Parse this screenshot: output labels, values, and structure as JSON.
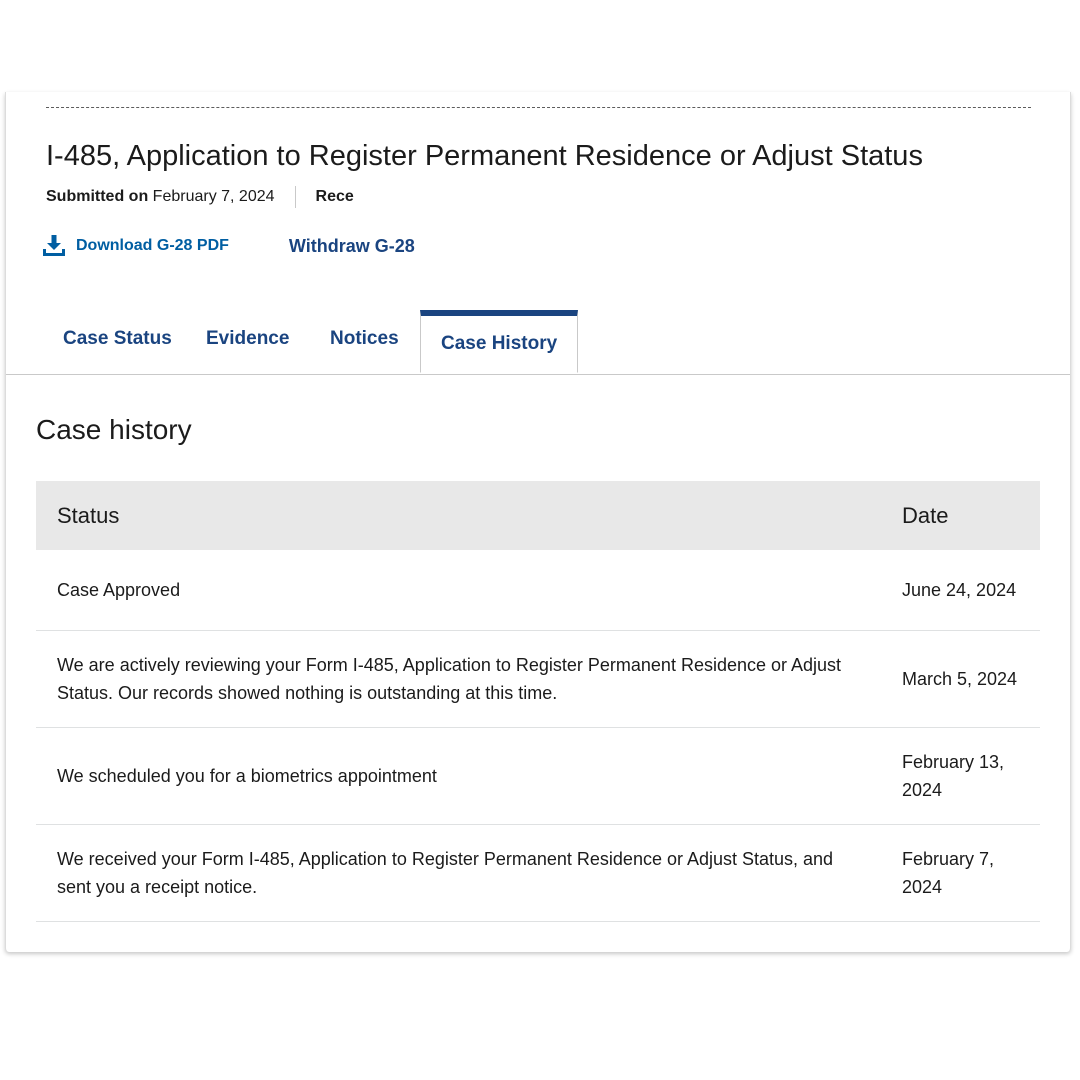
{
  "case": {
    "form_title": "I-485, Application to Register Permanent Residence or Adjust Status",
    "submitted_label": "Submitted on",
    "submitted_date": "February 7, 2024",
    "receipt_label_partial": "Rece"
  },
  "actions": {
    "download_label": "Download G-28 PDF",
    "download_icon": "download-icon",
    "withdraw_label": "Withdraw G-28"
  },
  "tabs": [
    {
      "label": "Case Status",
      "active": false
    },
    {
      "label": "Evidence",
      "active": false
    },
    {
      "label": "Notices",
      "active": false
    },
    {
      "label": "Case History",
      "active": true
    }
  ],
  "history": {
    "title": "Case history",
    "columns": {
      "status": "Status",
      "date": "Date"
    },
    "rows": [
      {
        "status": "Case Approved",
        "date": "June 24, 2024"
      },
      {
        "status": "We are actively reviewing your Form I-485, Application to Register Permanent Residence or Adjust Status. Our records showed nothing is outstanding at this time.",
        "date": "March 5, 2024"
      },
      {
        "status": "We scheduled you for a biometrics appointment",
        "date": "February 13, 2024"
      },
      {
        "status": "We received your Form I-485, Application to Register Permanent Residence or Adjust Status, and sent you a receipt notice.",
        "date": "February 7, 2024"
      }
    ]
  },
  "colors": {
    "link": "#005ea2",
    "tab_accent": "#1a4480",
    "header_bg": "#e8e8e8"
  }
}
